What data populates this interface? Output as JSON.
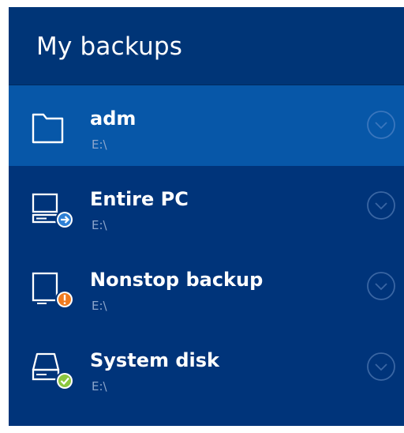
{
  "panel": {
    "title": "My backups"
  },
  "backups": [
    {
      "name": "adm",
      "path": "E:\\",
      "icon": "folder-icon",
      "badge": null,
      "selected": true
    },
    {
      "name": "Entire PC",
      "path": "E:\\",
      "icon": "computer-icon",
      "badge": "arrow-right-badge",
      "selected": false
    },
    {
      "name": "Nonstop backup",
      "path": "E:\\",
      "icon": "monitor-icon",
      "badge": "warning-badge",
      "selected": false
    },
    {
      "name": "System disk",
      "path": "E:\\",
      "icon": "disk-icon",
      "badge": "checkmark-badge",
      "selected": false
    }
  ],
  "colors": {
    "panel_bg": "#00347a",
    "selected_bg": "#0757a8",
    "badge_blue": "#2d7fd6",
    "badge_orange": "#f07a1f",
    "badge_green": "#8bc63f"
  }
}
